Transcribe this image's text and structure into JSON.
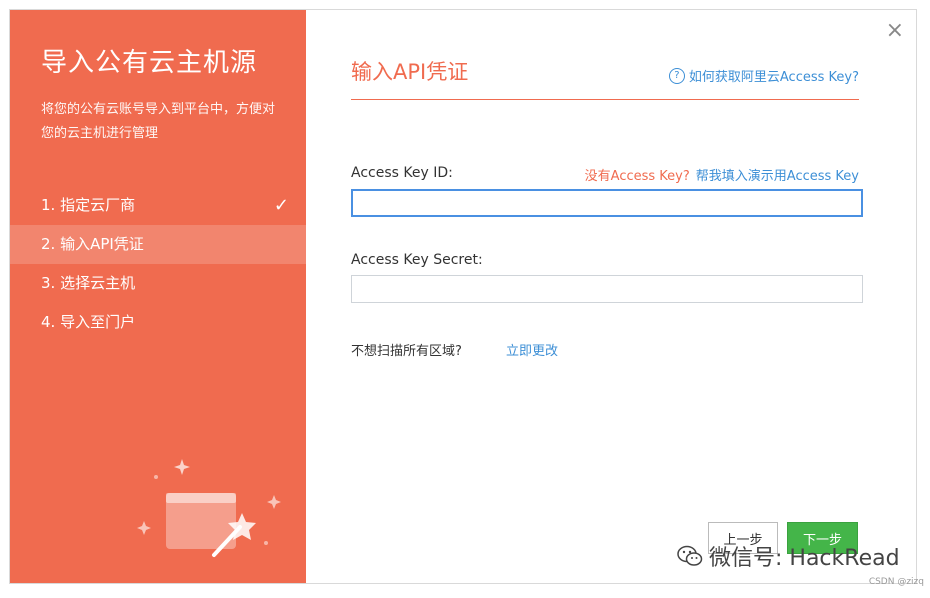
{
  "left_panel": {
    "title": "导入公有云主机源",
    "description": "将您的公有云账号导入到平台中，方便对您的云主机进行管理",
    "steps": [
      {
        "label": "1. 指定云厂商",
        "completed": true
      },
      {
        "label": "2. 输入API凭证",
        "active": true
      },
      {
        "label": "3. 选择云主机"
      },
      {
        "label": "4. 导入至门户"
      }
    ],
    "check_icon": "✓"
  },
  "right_panel": {
    "close_icon": "×",
    "heading": "输入API凭证",
    "help_icon": "?",
    "help_link": "如何获取阿里云Access Key?",
    "access_key_id_label": "Access Key ID:",
    "no_key_text": "没有Access Key?",
    "fill_demo_link": "帮我填入演示用Access Key",
    "access_key_id_value": "",
    "access_key_secret_label": "Access Key Secret:",
    "access_key_secret_value": "",
    "region_question": "不想扫描所有区域?",
    "region_change_link": "立即更改",
    "prev_button": "上一步",
    "next_button": "下一步"
  },
  "watermark": {
    "text": "微信号: HackRead",
    "csdn": "CSDN @zizq"
  },
  "colors": {
    "accent": "#f06b4f",
    "link": "#3d8fd6",
    "primary_button": "#44b549"
  }
}
